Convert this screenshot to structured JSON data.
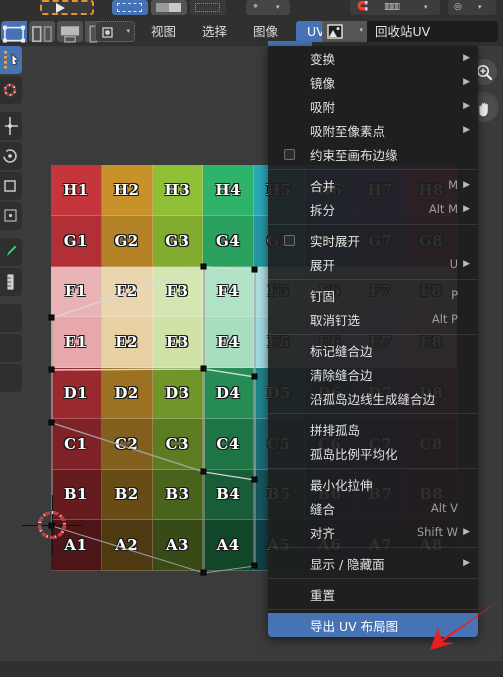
{
  "window": {
    "editor": "UV Editor",
    "background_color": "#3b3b3b"
  },
  "toolbar_top": {
    "icons": [
      {
        "name": "tweak-tool-icon",
        "label": ""
      },
      {
        "name": "select-box-icon",
        "label": ""
      },
      {
        "name": "select-gradient-icon",
        "label": ""
      },
      {
        "name": "select-lasso-icon",
        "label": ""
      },
      {
        "name": "pivot-point-icon",
        "label": ""
      },
      {
        "name": "snap-magnet-icon",
        "label": ""
      },
      {
        "name": "proportional-edit-icon",
        "label": ""
      }
    ]
  },
  "header": {
    "uv_sync_label": "",
    "select_modes": [
      "vertex",
      "edge",
      "face",
      "island"
    ],
    "menus": [
      {
        "id": "view",
        "label": "视图",
        "active": false
      },
      {
        "id": "select",
        "label": "选择",
        "active": false
      },
      {
        "id": "image",
        "label": "图像",
        "active": false
      },
      {
        "id": "uv",
        "label": "UV",
        "active": true
      }
    ],
    "image_browse_icon": "image-browse-icon",
    "image_name": "回收站UV"
  },
  "uv_menu": {
    "title": "UV",
    "items": [
      {
        "label": "变换",
        "shortcut": "",
        "submenu": true,
        "checkbox": false,
        "checked": false,
        "highlighted": false
      },
      {
        "label": "镜像",
        "shortcut": "",
        "submenu": true,
        "checkbox": false,
        "checked": false,
        "highlighted": false
      },
      {
        "label": "吸附",
        "shortcut": "",
        "submenu": true,
        "checkbox": false,
        "checked": false,
        "highlighted": false
      },
      {
        "label": "吸附至像素点",
        "shortcut": "",
        "submenu": true,
        "checkbox": false,
        "checked": false,
        "highlighted": false
      },
      {
        "label": "约束至画布边缘",
        "shortcut": "",
        "submenu": false,
        "checkbox": true,
        "checked": false,
        "highlighted": false
      },
      {
        "separator": true
      },
      {
        "label": "合并",
        "shortcut": "M",
        "submenu": true,
        "checkbox": false,
        "checked": false,
        "highlighted": false
      },
      {
        "label": "拆分",
        "shortcut": "Alt M",
        "submenu": true,
        "checkbox": false,
        "checked": false,
        "highlighted": false
      },
      {
        "separator": true
      },
      {
        "label": "实时展开",
        "shortcut": "",
        "submenu": false,
        "checkbox": true,
        "checked": false,
        "highlighted": false
      },
      {
        "label": "展开",
        "shortcut": "U",
        "submenu": true,
        "checkbox": false,
        "checked": false,
        "highlighted": false
      },
      {
        "separator": true
      },
      {
        "label": "钉固",
        "shortcut": "P",
        "submenu": false,
        "checkbox": false,
        "checked": false,
        "highlighted": false
      },
      {
        "label": "取消钉选",
        "shortcut": "Alt P",
        "submenu": false,
        "checkbox": false,
        "checked": false,
        "highlighted": false
      },
      {
        "separator": true
      },
      {
        "label": "标记缝合边",
        "shortcut": "",
        "submenu": false,
        "checkbox": false,
        "checked": false,
        "highlighted": false
      },
      {
        "label": "清除缝合边",
        "shortcut": "",
        "submenu": false,
        "checkbox": false,
        "checked": false,
        "highlighted": false
      },
      {
        "label": "沿孤岛边线生成缝合边",
        "shortcut": "",
        "submenu": false,
        "checkbox": false,
        "checked": false,
        "highlighted": false
      },
      {
        "separator": true
      },
      {
        "label": "拼排孤岛",
        "shortcut": "",
        "submenu": false,
        "checkbox": false,
        "checked": false,
        "highlighted": false
      },
      {
        "label": "孤岛比例平均化",
        "shortcut": "",
        "submenu": false,
        "checkbox": false,
        "checked": false,
        "highlighted": false
      },
      {
        "separator": true
      },
      {
        "label": "最小化拉伸",
        "shortcut": "",
        "submenu": false,
        "checkbox": false,
        "checked": false,
        "highlighted": false
      },
      {
        "label": "缝合",
        "shortcut": "Alt V",
        "submenu": false,
        "checkbox": false,
        "checked": false,
        "highlighted": false
      },
      {
        "label": "对齐",
        "shortcut": "Shift W",
        "submenu": true,
        "checkbox": false,
        "checked": false,
        "highlighted": false
      },
      {
        "separator": true
      },
      {
        "label": "显示 / 隐藏面",
        "shortcut": "",
        "submenu": true,
        "checkbox": false,
        "checked": false,
        "highlighted": false
      },
      {
        "separator": true
      },
      {
        "label": "重置",
        "shortcut": "",
        "submenu": false,
        "checkbox": false,
        "checked": false,
        "highlighted": false
      },
      {
        "separator": true
      },
      {
        "label": "导出 UV 布局图",
        "shortcut": "",
        "submenu": false,
        "checkbox": false,
        "checked": false,
        "highlighted": true
      }
    ]
  },
  "uv_canvas": {
    "grid_labels": [
      [
        "H1",
        "H2",
        "H3",
        "H4",
        "H5",
        "H6",
        "H7",
        "H8"
      ],
      [
        "G1",
        "G2",
        "G3",
        "G4",
        "G5",
        "G6",
        "G7",
        "G8"
      ],
      [
        "F1",
        "F2",
        "F3",
        "F4",
        "F5",
        "F6",
        "F7",
        "F8"
      ],
      [
        "E1",
        "E2",
        "E3",
        "E4",
        "E5",
        "E6",
        "E7",
        "E8"
      ],
      [
        "D1",
        "D2",
        "D3",
        "D4",
        "D5",
        "D6",
        "D7",
        "D8"
      ],
      [
        "C1",
        "C2",
        "C3",
        "C4",
        "C5",
        "C6",
        "C7",
        "C8"
      ],
      [
        "B1",
        "B2",
        "B3",
        "B4",
        "B5",
        "B6",
        "B7",
        "B8"
      ],
      [
        "A1",
        "A2",
        "A3",
        "A4",
        "A5",
        "A6",
        "A7",
        "A8"
      ]
    ],
    "column_colors": [
      "#c4353c",
      "#c8922b",
      "#8fbf35",
      "#2fb36a",
      "#2aa7b5",
      "#3d6fbe",
      "#7e4fb8",
      "#b8428f"
    ],
    "cursor_name": "2d-cursor"
  },
  "gizmos": {
    "zoom_icon": "zoom-magnifier-icon",
    "pan_icon": "pan-hand-icon"
  },
  "annotation": {
    "arrow_color": "#e8201f",
    "arrow_name": "red-pointer-arrow"
  }
}
